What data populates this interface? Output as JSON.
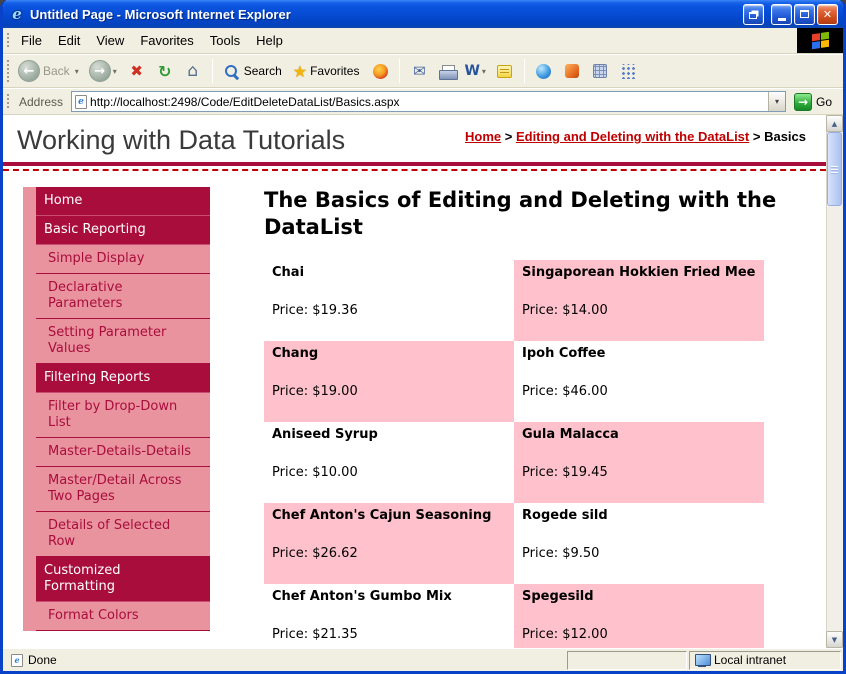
{
  "colors": {
    "maroon": "#a90d3c",
    "sidebar_pink": "#e9939e",
    "cell_pink": "#ffc2cc",
    "link_red": "#c00000"
  },
  "icons": {
    "ie_logo": "e",
    "close": "✕",
    "back": "←",
    "forward": "→",
    "dropdown": "▾",
    "stop": "✖",
    "refresh": "↻",
    "home": "⌂",
    "favorites_star": "★",
    "mail": "✉",
    "word": "W",
    "go_arrow": "→",
    "page_e": "e",
    "scroll_up": "▲",
    "scroll_down": "▼"
  },
  "window": {
    "title": "Untitled Page - Microsoft Internet Explorer"
  },
  "menu_bar": {
    "items": [
      "File",
      "Edit",
      "View",
      "Favorites",
      "Tools",
      "Help"
    ]
  },
  "toolbar": {
    "back_label": "Back",
    "search_label": "Search",
    "favorites_label": "Favorites"
  },
  "address_bar": {
    "label": "Address",
    "url": "http://localhost:2498/Code/EditDeleteDataList/Basics.aspx",
    "go_label": "Go"
  },
  "page": {
    "site_title": "Working with Data Tutorials",
    "breadcrumb": {
      "separator": ">",
      "items": [
        {
          "label": "Home",
          "link": true
        },
        {
          "label": "Editing and Deleting with the DataList",
          "link": true
        },
        {
          "label": "Basics",
          "link": false
        }
      ]
    },
    "sidebar": {
      "items": [
        {
          "label": "Home",
          "type": "section"
        },
        {
          "label": "Basic Reporting",
          "type": "section"
        },
        {
          "label": "Simple Display",
          "type": "sub"
        },
        {
          "label": "Declarative Parameters",
          "type": "sub"
        },
        {
          "label": "Setting Parameter Values",
          "type": "sub"
        },
        {
          "label": "Filtering Reports",
          "type": "section"
        },
        {
          "label": "Filter by Drop-Down List",
          "type": "sub"
        },
        {
          "label": "Master-Details-Details",
          "type": "sub"
        },
        {
          "label": "Master/Detail Across Two Pages",
          "type": "sub"
        },
        {
          "label": "Details of Selected Row",
          "type": "sub"
        },
        {
          "label": "Customized Formatting",
          "type": "section"
        },
        {
          "label": "Format Colors",
          "type": "sub"
        }
      ]
    },
    "heading": "The Basics of Editing and Deleting with the DataList",
    "products": [
      {
        "name": "Chai",
        "price": "Price: $19.36",
        "pink": false
      },
      {
        "name": "Singaporean Hokkien Fried Mee",
        "price": "Price: $14.00",
        "pink": true
      },
      {
        "name": "Chang",
        "price": "Price: $19.00",
        "pink": true
      },
      {
        "name": "Ipoh Coffee",
        "price": "Price: $46.00",
        "pink": false
      },
      {
        "name": "Aniseed Syrup",
        "price": "Price: $10.00",
        "pink": false
      },
      {
        "name": "Gula Malacca",
        "price": "Price: $19.45",
        "pink": true
      },
      {
        "name": "Chef Anton's Cajun Seasoning",
        "price": "Price: $26.62",
        "pink": true
      },
      {
        "name": "Rogede sild",
        "price": "Price: $9.50",
        "pink": false
      },
      {
        "name": "Chef Anton's Gumbo Mix",
        "price": "Price: $21.35",
        "pink": false
      },
      {
        "name": "Spegesild",
        "price": "Price: $12.00",
        "pink": true
      }
    ]
  },
  "status_bar": {
    "left": "Done",
    "zone": "Local intranet"
  }
}
